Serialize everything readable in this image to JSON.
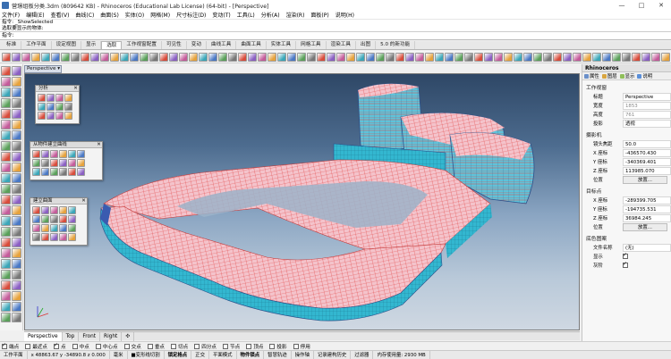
{
  "window": {
    "title": "营璟组板分类.3dm (809642 KB) - Rhinoceros (Educational Lab License) (64-bit) - [Perspective]",
    "minimize": "—",
    "maximize": "□",
    "close": "✕"
  },
  "menu": [
    "文件(F)",
    "编辑(E)",
    "查看(V)",
    "曲线(C)",
    "曲面(S)",
    "实体(O)",
    "网格(M)",
    "尺寸标注(D)",
    "变动(T)",
    "工具(L)",
    "分析(A)",
    "渲染(R)",
    "面板(P)",
    "说明(H)"
  ],
  "command": {
    "history": [
      "指令: _ShowSelected",
      "选取要显示的物体:"
    ],
    "prompt": "指令:"
  },
  "tabs": [
    "标准",
    "工作平面",
    "设定视图",
    "显示",
    "选取",
    "工作视窗配置",
    "可见性",
    "变动",
    "曲线工具",
    "曲面工具",
    "实体工具",
    "网格工具",
    "渲染工具",
    "出图",
    "5.0 的新功能"
  ],
  "active_tab_index": 4,
  "viewport": {
    "tab_label": "Perspective",
    "dropdown_icon": "▾"
  },
  "panels": {
    "analysis": {
      "title": "分析",
      "close": "✕"
    },
    "from_object": {
      "title": "从物件建立曲线",
      "close": "✕"
    },
    "create_surface": {
      "title": "建立曲面",
      "close": "✕"
    }
  },
  "view_tabs": [
    "Perspective",
    "Top",
    "Front",
    "Right",
    "✣"
  ],
  "osnaps": [
    {
      "label": "端点",
      "checked": true
    },
    {
      "label": "最近点",
      "checked": false
    },
    {
      "label": "点",
      "checked": true
    },
    {
      "label": "中点",
      "checked": false
    },
    {
      "label": "中心点",
      "checked": false
    },
    {
      "label": "交点",
      "checked": false
    },
    {
      "label": "垂点",
      "checked": false
    },
    {
      "label": "切点",
      "checked": false
    },
    {
      "label": "四分点",
      "checked": false
    },
    {
      "label": "节点",
      "checked": false
    },
    {
      "label": "顶点",
      "checked": false
    },
    {
      "label": "投影",
      "checked": false
    },
    {
      "label": "停用",
      "checked": false
    }
  ],
  "status": {
    "cplane": "工作平面",
    "coords": "x 48863.67  y -34890.8  z 0.000",
    "units": "毫米",
    "layer": "■变形线切割",
    "items": [
      "锁定格点",
      "正交",
      "平面模式",
      "物件锁点",
      "智慧轨迹",
      "操作轴",
      "记录建构历史",
      "过滤器",
      "内存使用量: 2930 MB"
    ],
    "bold_items": [
      "锁定格点",
      "物件锁点"
    ]
  },
  "properties": {
    "panel_title": "Rhinoceros",
    "tabs": [
      "属性",
      "图层",
      "显示",
      "说明"
    ],
    "tab_colors": [
      "#6a8fc9",
      "#d9a640",
      "#8fbf5a",
      "#5a8fd9"
    ],
    "viewport_section": "工作视窗",
    "fields": {
      "title_label": "标题",
      "title_value": "Perspective",
      "width_label": "宽度",
      "width_value": "1853",
      "height_label": "高度",
      "height_value": "761",
      "projection_label": "投影",
      "projection_value": "透视"
    },
    "camera_section": "摄影机",
    "camera": {
      "lens_label": "镜头焦距",
      "lens_value": "50.0",
      "x_label": "X 座标",
      "x_value": "-436570.430",
      "y_label": "Y 座标",
      "y_value": "-340369.401",
      "z_label": "Z 座标",
      "z_value": "113985.070",
      "pos_label": "位置",
      "pos_button": "放置..."
    },
    "target_section": "目标点",
    "target": {
      "x_label": "X 座标",
      "x_value": "-289399.705",
      "y_label": "Y 座标",
      "y_value": "-194735.531",
      "z_label": "Z 座标",
      "z_value": "36984.245",
      "pos_label": "位置",
      "pos_button": "放置..."
    },
    "wallpaper_section": "底色图案",
    "wallpaper": {
      "file_label": "文件名称",
      "file_value": "(无)",
      "show_label": "显示",
      "show_checked": true,
      "gray_label": "灰阶",
      "gray_checked": true
    }
  },
  "colors": {
    "mesh_red": "#e24848",
    "mesh_cyan": "#33b7d0",
    "mesh_pink": "#f3b8c2",
    "mesh_blue": "#3a5bb0"
  }
}
